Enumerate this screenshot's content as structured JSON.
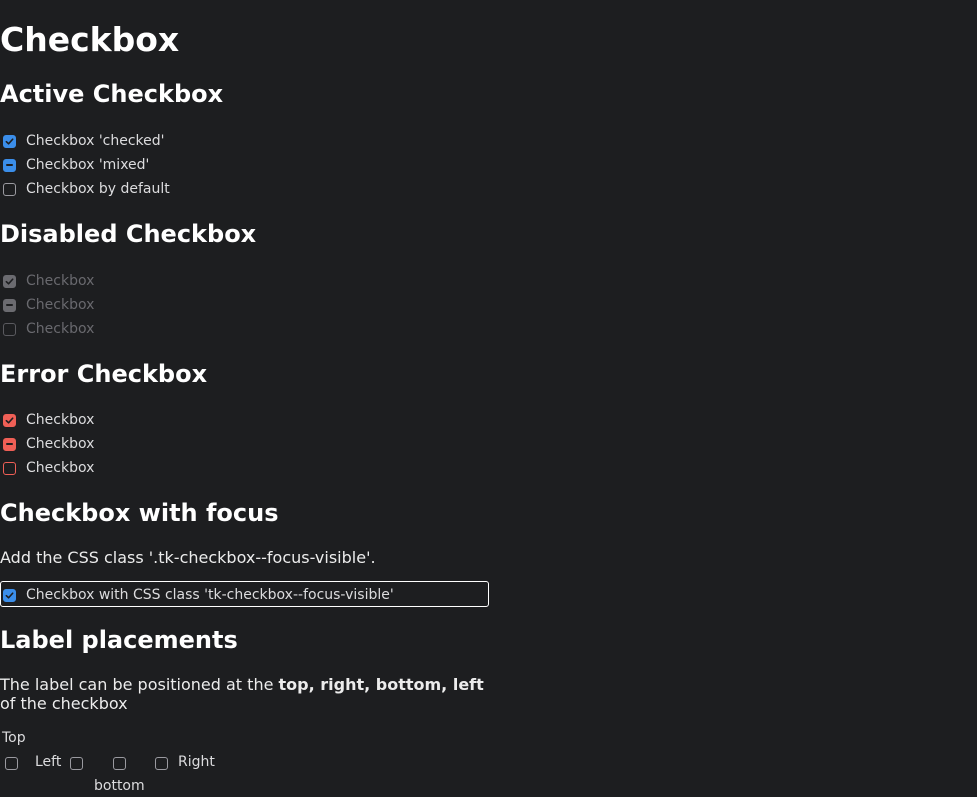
{
  "title": "Checkbox",
  "active": {
    "heading": "Active Checkbox",
    "items": [
      {
        "label": "Checkbox 'checked'",
        "state": "checked"
      },
      {
        "label": "Checkbox 'mixed'",
        "state": "mixed"
      },
      {
        "label": "Checkbox by default",
        "state": "unchecked"
      }
    ]
  },
  "disabled": {
    "heading": "Disabled Checkbox",
    "items": [
      {
        "label": "Checkbox",
        "state": "checked"
      },
      {
        "label": "Checkbox",
        "state": "mixed"
      },
      {
        "label": "Checkbox",
        "state": "unchecked"
      }
    ]
  },
  "error": {
    "heading": "Error Checkbox",
    "items": [
      {
        "label": "Checkbox",
        "state": "checked"
      },
      {
        "label": "Checkbox",
        "state": "mixed"
      },
      {
        "label": "Checkbox",
        "state": "unchecked"
      }
    ]
  },
  "focus": {
    "heading": "Checkbox with focus",
    "description": "Add the CSS class '.tk-checkbox--focus-visible'.",
    "item_label": "Checkbox with CSS class 'tk-checkbox--focus-visible'"
  },
  "placements": {
    "heading": "Label placements",
    "desc_prefix": "The label can be positioned at the ",
    "desc_bold": "top, right, bottom, left",
    "desc_suffix": "of the checkbox",
    "top": "Top",
    "left": "Left",
    "bottom": "bottom",
    "right": "Right"
  },
  "colors": {
    "background": "#1d1e20",
    "accent": "#3b8eea",
    "error": "#ef5f56",
    "disabled": "#6b6b70"
  }
}
